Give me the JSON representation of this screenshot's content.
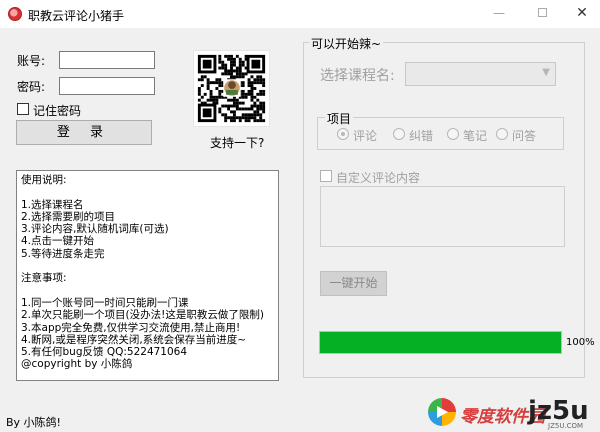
{
  "window": {
    "title": "职教云评论小猪手",
    "minimize_glyph": "—",
    "close_glyph": "✕"
  },
  "login": {
    "account_label": "账号:",
    "password_label": "密码:",
    "account_value": "",
    "password_value": "",
    "remember_label": "记住密码",
    "remember_checked": false,
    "login_button": "登 录"
  },
  "support": {
    "caption": "支持一下?"
  },
  "instructions": {
    "text": "使用说明:\n\n1.选择课程名\n2.选择需要刷的项目\n3.评论内容,默认随机词库(可选)\n4.点击一键开始\n5.等待进度条走完\n\n注意事项:\n\n1.同一个账号同一时间只能刷一门课\n2.单次只能刷一个项目(没办法!这是职教云做了限制)\n3.本app完全免费,仅供学习交流使用,禁止商用!\n4.断网,或是程序突然关闭,系统会保存当前进度~\n5.有任何bug反馈 QQ:522471064\n@copyright by 小陈鸽"
  },
  "status_bar": {
    "text": "By 小陈鸽!"
  },
  "main_group": {
    "title": "可以开始辣~",
    "course_label": "选择课程名:",
    "course_selected": "",
    "project_group_title": "项目",
    "options": [
      "评论",
      "纠错",
      "笔记",
      "问答"
    ],
    "selected_option": 0,
    "custom_comment_label": "自定义评论内容",
    "custom_comment_value": "",
    "start_button": "一键开始",
    "progress_value": 100,
    "progress_text": "100%"
  },
  "watermark": {
    "brand": "零度软件园",
    "big": "jz5u",
    "url": "JZ5U.COM"
  },
  "colors": {
    "progress_fill": "#06b025",
    "window_bg": "#f0f0f0",
    "disabled_text": "#a0a0a0"
  }
}
